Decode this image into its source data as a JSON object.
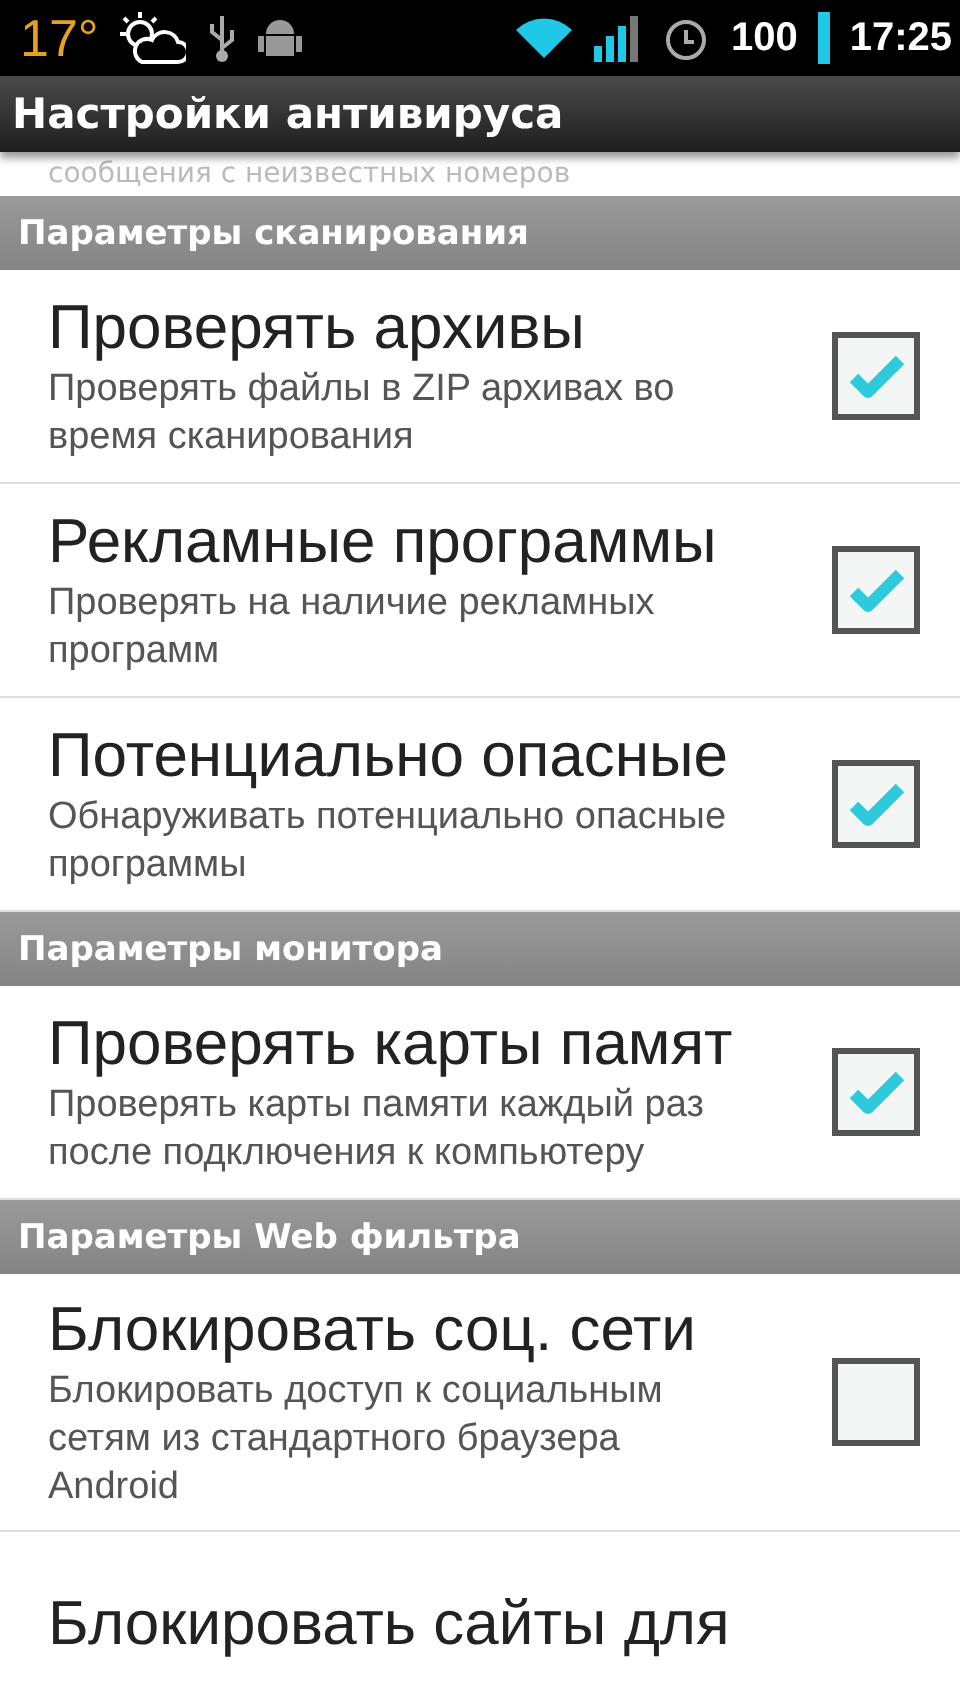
{
  "status_bar": {
    "temperature": "17°",
    "battery": "100",
    "time": "17:25"
  },
  "title_bar": {
    "title": "Настройки антивируса"
  },
  "partial_item": {
    "summary": "сообщения с неизвестных номеров"
  },
  "sections": [
    {
      "header": "Параметры сканирования",
      "items": [
        {
          "title": "Проверять архивы",
          "summary": "Проверять файлы в ZIP архивах во время сканирования",
          "checked": true
        },
        {
          "title": "Рекламные программы",
          "summary": "Проверять на наличие рекламных программ",
          "checked": true
        },
        {
          "title": "Потенциально опасные",
          "summary": "Обнаруживать потенциально опасные программы",
          "checked": true
        }
      ]
    },
    {
      "header": "Параметры монитора",
      "items": [
        {
          "title": "Проверять карты памят",
          "summary": "Проверять карты памяти каждый раз после подключения к компьютеру",
          "checked": true
        }
      ]
    },
    {
      "header": "Параметры Web фильтра",
      "items": [
        {
          "title": "Блокировать соц. сети",
          "summary": "Блокировать доступ к социальным сетям из стандартного браузера Android",
          "checked": false
        },
        {
          "title": "Блокировать сайты для"
        }
      ]
    }
  ]
}
